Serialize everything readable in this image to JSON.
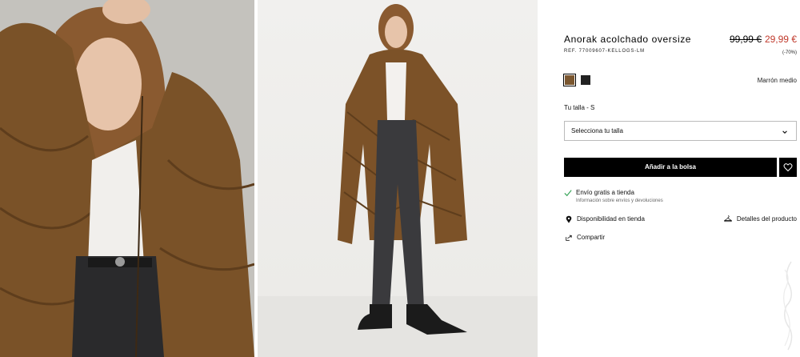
{
  "product": {
    "title": "Anorak acolchado oversize",
    "ref": "REF. 77009607-KELLOGS-LM",
    "price_old": "99,99 €",
    "price_new": "29,99 €",
    "discount": "(-70%)"
  },
  "colors": {
    "selected_name": "Marrón medio",
    "swatches": [
      {
        "name": "brown",
        "hex": "#7b5730"
      },
      {
        "name": "black",
        "hex": "#222222"
      }
    ]
  },
  "size": {
    "label": "Tu talla - S",
    "placeholder": "Selecciona tu talla"
  },
  "actions": {
    "add_to_bag": "Añadir a la bolsa"
  },
  "shipping": {
    "title": "Envío gratis a tienda",
    "subtitle": "Información sobre envíos y devoluciones"
  },
  "links": {
    "availability": "Disponibilidad en tienda",
    "details": "Detalles del producto",
    "share": "Compartir"
  },
  "colors_accent": {
    "sale_red": "#c0392b",
    "button_black": "#000000",
    "shipping_green": "#3aa55a"
  }
}
